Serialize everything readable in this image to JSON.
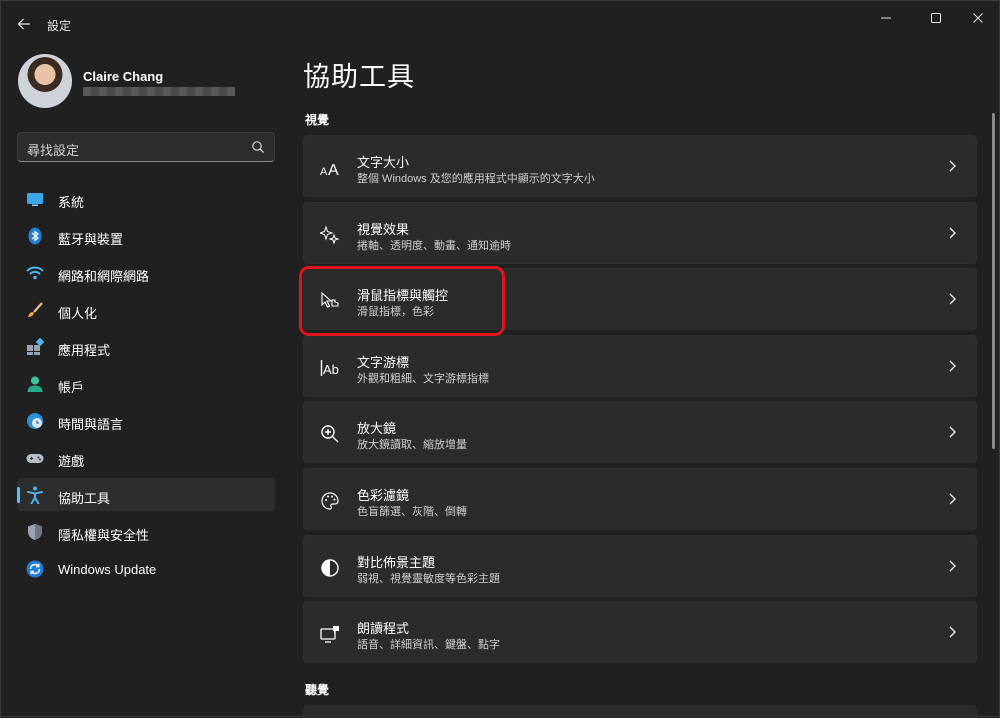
{
  "window": {
    "title": "設定"
  },
  "profile": {
    "name": "Claire Chang"
  },
  "search": {
    "placeholder": "尋找設定"
  },
  "sidebar": {
    "items": [
      {
        "label": "系統",
        "icon": "monitor-icon"
      },
      {
        "label": "藍牙與裝置",
        "icon": "bluetooth-icon"
      },
      {
        "label": "網路和網際網路",
        "icon": "wifi-icon"
      },
      {
        "label": "個人化",
        "icon": "brush-icon"
      },
      {
        "label": "應用程式",
        "icon": "apps-icon"
      },
      {
        "label": "帳戶",
        "icon": "person-icon"
      },
      {
        "label": "時間與語言",
        "icon": "clock-globe-icon"
      },
      {
        "label": "遊戲",
        "icon": "gamepad-icon"
      },
      {
        "label": "協助工具",
        "icon": "accessibility-icon",
        "selected": true
      },
      {
        "label": "隱私權與安全性",
        "icon": "shield-icon"
      },
      {
        "label": "Windows Update",
        "icon": "update-icon"
      }
    ]
  },
  "main": {
    "title": "協助工具",
    "sections": [
      {
        "title": "視覺",
        "cards": [
          {
            "title": "文字大小",
            "subtitle": "整個 Windows 及您的應用程式中顯示的文字大小",
            "icon": "text-size-icon"
          },
          {
            "title": "視覺效果",
            "subtitle": "捲軸、透明度、動畫、通知逾時",
            "icon": "sparkle-icon"
          },
          {
            "title": "滑鼠指標與觸控",
            "subtitle": "滑鼠指標，色彩",
            "icon": "pointer-touch-icon",
            "highlighted": true
          },
          {
            "title": "文字游標",
            "subtitle": "外觀和粗細、文字游標指標",
            "icon": "text-cursor-icon"
          },
          {
            "title": "放大鏡",
            "subtitle": "放大鏡讀取、縮放增量",
            "icon": "magnifier-icon"
          },
          {
            "title": "色彩濾鏡",
            "subtitle": "色盲篩選、灰階、倒轉",
            "icon": "palette-icon"
          },
          {
            "title": "對比佈景主題",
            "subtitle": "弱視、視覺靈敏度等色彩主題",
            "icon": "contrast-icon"
          },
          {
            "title": "朗讀程式",
            "subtitle": "語音、詳細資訊、鍵盤、點字",
            "icon": "narrator-icon"
          }
        ]
      },
      {
        "title": "聽覺"
      }
    ]
  },
  "colors": {
    "accent": "#4cc2ff",
    "highlight": "#e0141e",
    "background": "#202020",
    "card": "#2b2b2b"
  }
}
